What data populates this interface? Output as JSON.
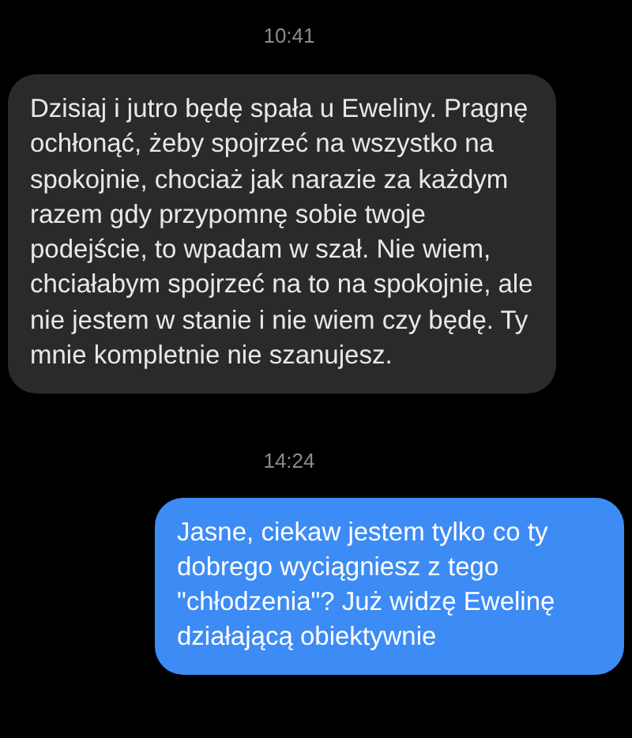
{
  "conversation": [
    {
      "kind": "time",
      "text": "10:41"
    },
    {
      "kind": "incoming",
      "text": "Dzisiaj i jutro będę spała u Eweliny. Pragnę ochłonąć, żeby spojrzeć na wszystko na spokojnie, chociaż jak narazie za każdym razem gdy przypomnę sobie twoje podejście, to wpadam w szał. Nie wiem, chciałabym spojrzeć na to na spokojnie, ale nie jestem w stanie i nie wiem czy będę. Ty mnie kompletnie nie szanujesz."
    },
    {
      "kind": "time",
      "text": "14:24"
    },
    {
      "kind": "outgoing",
      "text": "Jasne, ciekaw jestem tylko co ty dobrego wyciągniesz z tego \"chłodzenia\"? Już widzę Ewelinę działającą obiektywnie"
    }
  ]
}
